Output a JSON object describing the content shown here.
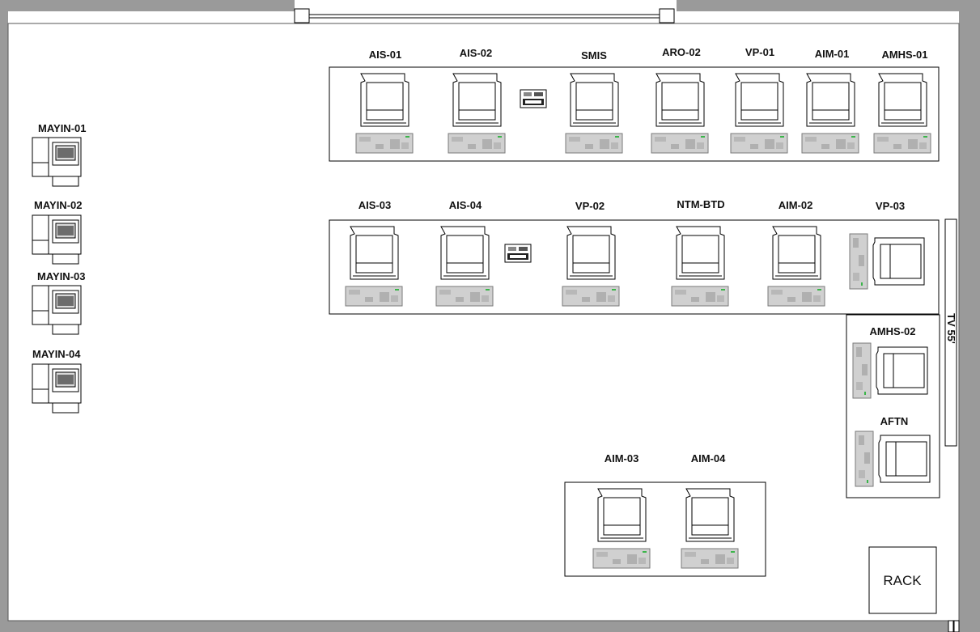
{
  "colors": {
    "wall": "#9a9a9a",
    "line": "#000000",
    "monitor_fill": "#ffffff",
    "keyboard": "#d0d0d0",
    "keyboard_key": "#a8a8a8",
    "led": "#3bb54a"
  },
  "rows": {
    "row1": [
      "AIS-01",
      "AIS-02",
      "SMIS",
      "ARO-02",
      "VP-01",
      "AIM-01",
      "AMHS-01"
    ],
    "row2": [
      "AIS-03",
      "AIS-04",
      "VP-02",
      "NTM-BTD",
      "AIM-02",
      "VP-03"
    ],
    "row3": [
      "AIM-03",
      "AIM-04"
    ],
    "side": [
      "AMHS-02",
      "AFTN"
    ]
  },
  "mayin": [
    "MAYIN-01",
    "MAYIN-02",
    "MAYIN-03",
    "MAYIN-04"
  ],
  "tv_label": "TV 55'",
  "rack_label": "RACK"
}
